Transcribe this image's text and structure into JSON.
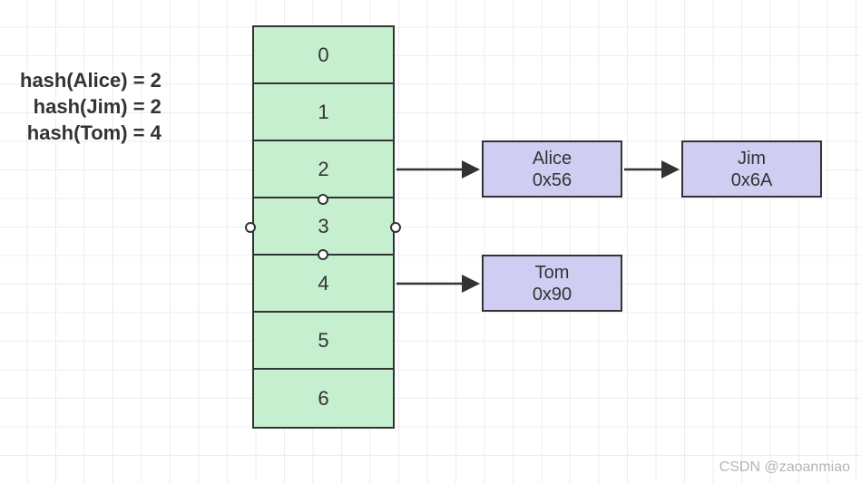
{
  "hash_lines": [
    "hash(Alice) = 2",
    "hash(Jim) = 2",
    "hash(Tom) = 4"
  ],
  "slots": [
    "0",
    "1",
    "2",
    "3",
    "4",
    "5",
    "6"
  ],
  "nodes": {
    "alice": {
      "name": "Alice",
      "addr": "0x56"
    },
    "jim": {
      "name": "Jim",
      "addr": "0x6A"
    },
    "tom": {
      "name": "Tom",
      "addr": "0x90"
    }
  },
  "watermark": "CSDN @zaoanmiao"
}
